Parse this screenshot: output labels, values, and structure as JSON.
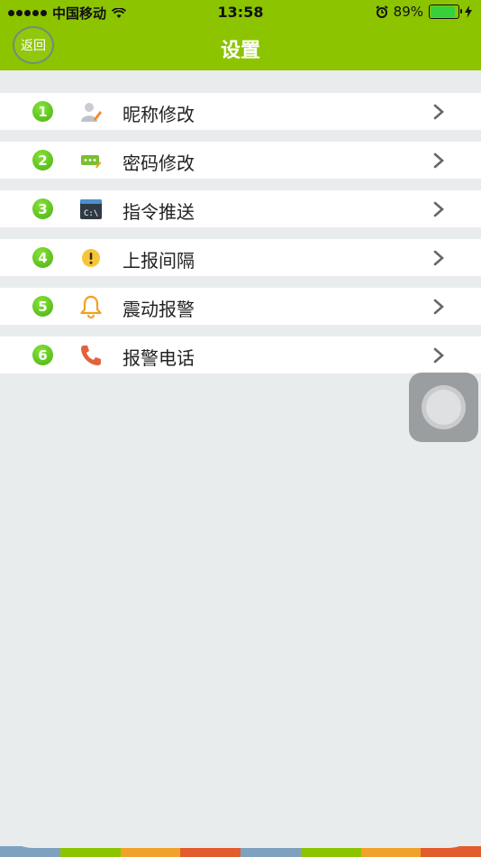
{
  "status_bar": {
    "carrier": "中国移动",
    "time": "13:58",
    "battery": "89%",
    "battery_level": 0.89
  },
  "nav": {
    "back_label": "返回",
    "title": "设置"
  },
  "menu": [
    {
      "number": "1",
      "label": "昵称修改",
      "icon": "user-edit-icon"
    },
    {
      "number": "2",
      "label": "密码修改",
      "icon": "password-icon"
    },
    {
      "number": "3",
      "label": "指令推送",
      "icon": "terminal-icon"
    },
    {
      "number": "4",
      "label": "上报间隔",
      "icon": "alert-icon"
    },
    {
      "number": "5",
      "label": "震动报警",
      "icon": "bell-icon"
    },
    {
      "number": "6",
      "label": "报警电话",
      "icon": "phone-icon"
    }
  ],
  "bottom_bar_colors": [
    "#7fa1c0",
    "#8cc400",
    "#f0a22a",
    "#e35c2d",
    "#7fa1c0",
    "#8cc400",
    "#f0a22a",
    "#e35c2d"
  ]
}
